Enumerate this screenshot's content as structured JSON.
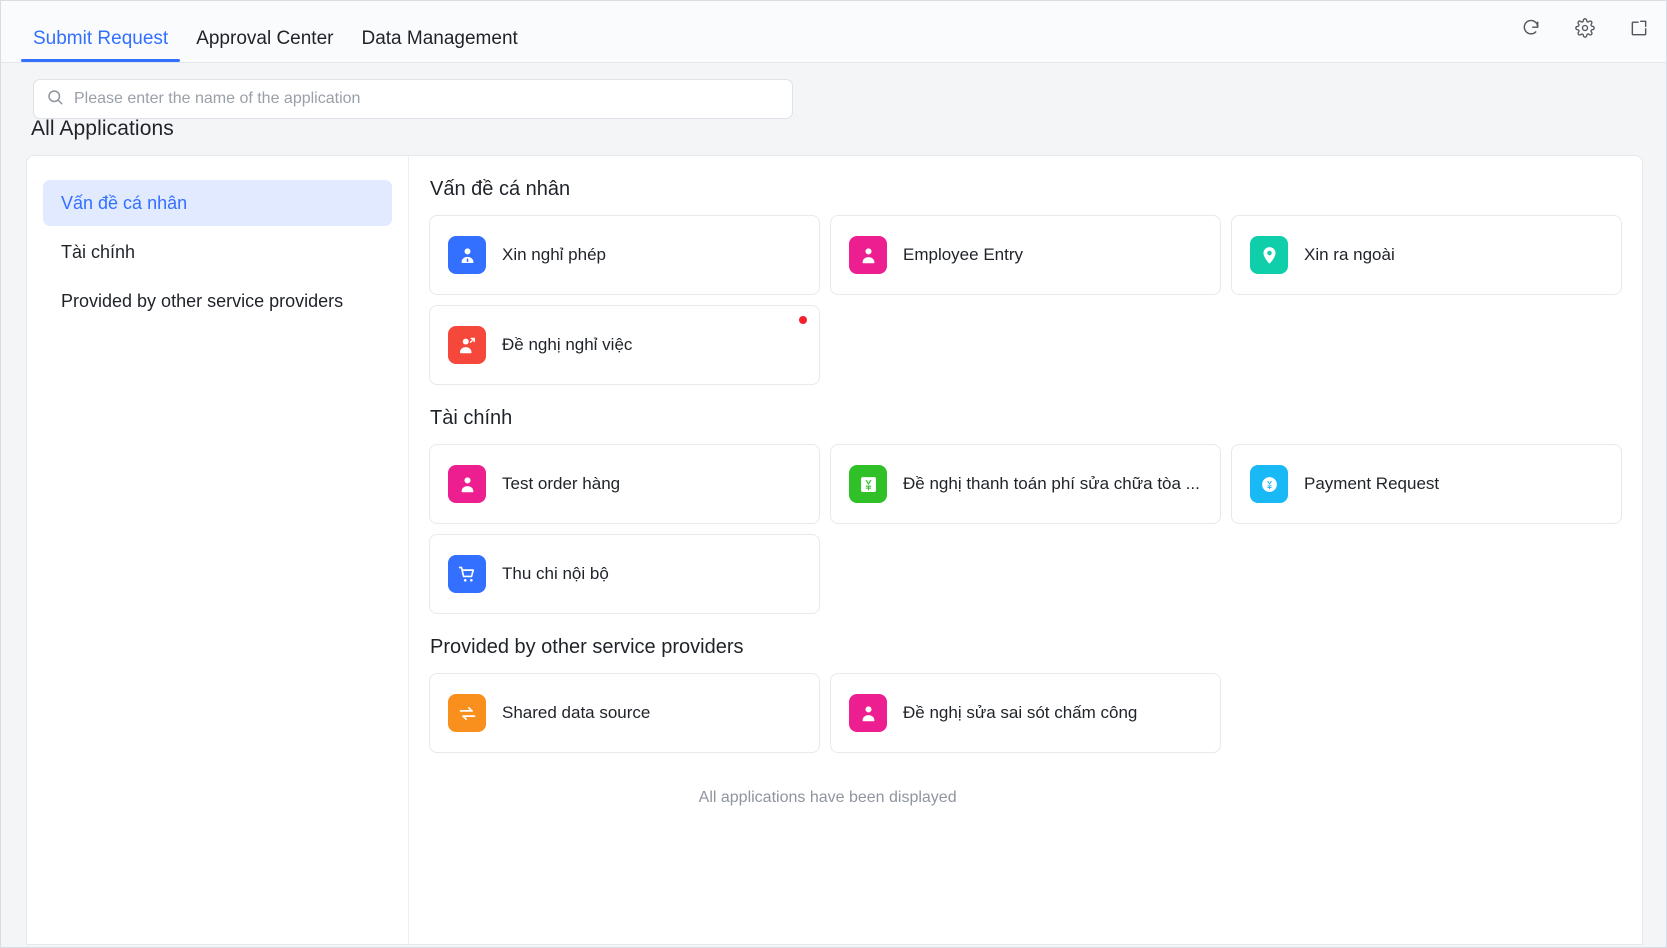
{
  "tabbar": {
    "tabs": [
      {
        "label": "Submit Request",
        "active": true
      },
      {
        "label": "Approval Center",
        "active": false
      },
      {
        "label": "Data Management",
        "active": false
      }
    ],
    "actions": [
      {
        "name": "refresh-icon"
      },
      {
        "name": "gear-icon"
      },
      {
        "name": "popout-window-icon"
      }
    ]
  },
  "search": {
    "placeholder": "Please enter the name of the application",
    "value": "",
    "icon": "search-icon"
  },
  "page": {
    "heading": "All Applications",
    "footer_note": "All applications have been displayed"
  },
  "sidebar": {
    "items": [
      {
        "label": "Vấn đề cá nhân",
        "active": true
      },
      {
        "label": "Tài chính",
        "active": false
      },
      {
        "label": "Provided by other service providers",
        "active": false
      }
    ]
  },
  "colors": {
    "accent": "#3370ff",
    "sidebar_active_bg": "#e1eaff",
    "badge_red": "#f5222d",
    "icon_blue": "#3370ff",
    "icon_magenta": "#ec1e90",
    "icon_teal": "#0fcfaa",
    "icon_red": "#f5483b",
    "icon_green": "#2fc127",
    "icon_cyan": "#18b9f5",
    "icon_orange": "#f98f1c"
  },
  "groups": [
    {
      "title": "Vấn đề cá nhân",
      "cards": [
        {
          "label": "Xin nghỉ phép",
          "icon": "person-badge-icon",
          "color": "#3370ff",
          "badge": false
        },
        {
          "label": "Employee Entry",
          "icon": "person-icon",
          "color": "#ec1e90",
          "badge": false
        },
        {
          "label": "Xin ra ngoài",
          "icon": "location-pin-icon",
          "color": "#0fcfaa",
          "badge": false
        },
        {
          "label": "Đề nghị nghỉ việc",
          "icon": "person-exit-icon",
          "color": "#f5483b",
          "badge": true
        }
      ]
    },
    {
      "title": "Tài chính",
      "cards": [
        {
          "label": "Test order hàng",
          "icon": "person-icon",
          "color": "#ec1e90",
          "badge": false
        },
        {
          "label": "Đề nghị thanh toán phí sửa chữa tòa ...",
          "icon": "currency-yen-icon",
          "color": "#2fc127",
          "badge": false
        },
        {
          "label": "Payment Request",
          "icon": "currency-yen-circle-icon",
          "color": "#18b9f5",
          "badge": false
        },
        {
          "label": "Thu chi nội bộ",
          "icon": "shopping-cart-icon",
          "color": "#3370ff",
          "badge": false
        }
      ]
    },
    {
      "title": "Provided by other service providers",
      "cards": [
        {
          "label": "Shared data source",
          "icon": "exchange-arrows-icon",
          "color": "#f98f1c",
          "badge": false
        },
        {
          "label": "Đề nghị sửa sai sót chấm công",
          "icon": "person-icon",
          "color": "#ec1e90",
          "badge": false
        }
      ]
    }
  ]
}
